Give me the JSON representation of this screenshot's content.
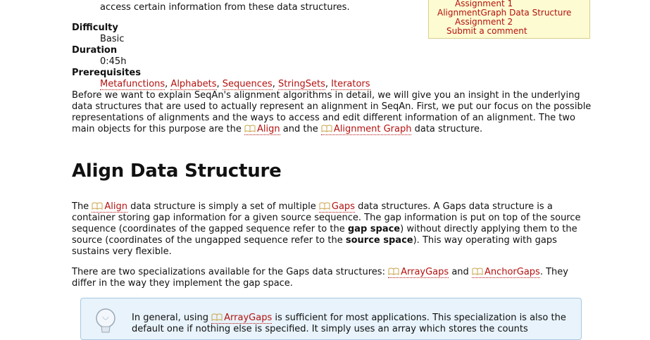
{
  "intro": {
    "line": "access certain information from these data structures."
  },
  "meta": {
    "difficulty_label": "Difficulty",
    "difficulty_value": "Basic",
    "duration_label": "Duration",
    "duration_value": "0:45h",
    "prerequisites_label": "Prerequisites",
    "prerequisites": [
      "Metafunctions",
      "Alphabets",
      "Sequences",
      "StringSets",
      "Iterators"
    ]
  },
  "toc": {
    "items": [
      "Assignment 1",
      "AlignmentGraph Data Structure",
      "Assignment 2",
      "Submit a comment"
    ]
  },
  "para1": {
    "text": "Before we want to explain SeqAn's alignment algorithms in detail, we will give you an insight in the underlying data structures that are used to actually represent an alignment in SeqAn. First, we put our focus on the possible representations of alignments and the ways to access and edit different information of an alignment. The two main objects for this purpose are the",
    "link1": "Align",
    "and": "and the",
    "link2": "Alignment Graph",
    "tail": "data structure."
  },
  "heading": "Align Data Structure",
  "para2": {
    "the": "The",
    "link_align": "Align",
    "t1": "data structure is simply a set of multiple",
    "link_gaps": "Gaps",
    "t2": "data structures. A Gaps data structure is a container storing gap information for a given source sequence. The gap information is put on top of the source sequence (coordinates of the gapped sequence refer to the",
    "bold1": "gap space",
    "t3": ") without directly applying them to the source (coordinates of the ungapped sequence refer to the",
    "bold2": "source space",
    "t4": "). This way operating with gaps sustains very flexible."
  },
  "para3": {
    "t1": "There are two specializations available for the Gaps data structures:",
    "link1": "ArrayGaps",
    "and": "and",
    "link2": "AnchorGaps",
    "t2": ". They differ in the way they implement the gap space."
  },
  "note": {
    "t1": "In general, using",
    "link": "ArrayGaps",
    "t2": "is sufficient for most applications. This specialization is also the default one if nothing else is specified. It simply uses an array which stores the counts"
  },
  "icons": {
    "book": "book-icon",
    "bulb": "lightbulb-icon"
  },
  "colors": {
    "link": "#b3120f",
    "toc_bg": "#fdfbd2",
    "note_bg": "#e8f3fb"
  }
}
